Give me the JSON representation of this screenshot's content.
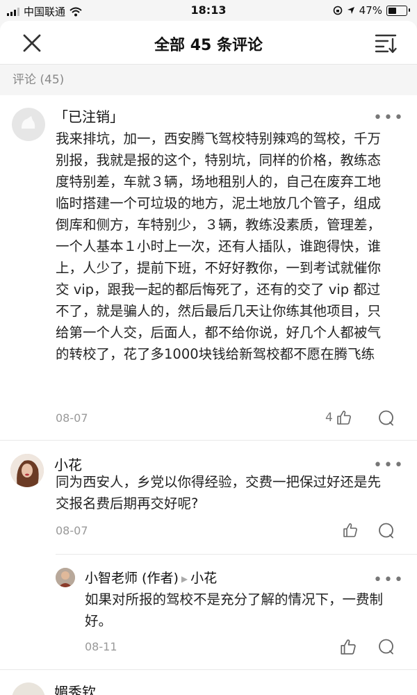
{
  "status_bar": {
    "carrier": "中国联通",
    "time": "18:13",
    "battery": "47%",
    "battery_level": 0.47
  },
  "header": {
    "title": "全部 45 条评论"
  },
  "comments_label": "评论 (45)",
  "comments": [
    {
      "username": "「已注销」",
      "text": "我来排坑，加一，西安腾飞驾校特别辣鸡的驾校，千万别报，我就是报的这个，特别坑，同样的价格，教练态度特别差，车就３辆，场地租别人的，自己在废弃工地临时搭建一个可垃圾的地方，泥土地放几个管子，组成倒库和侧方，车特别少，３辆，教练没素质，管理差，一个人基本１小时上一次，还有人插队，谁跑得快，谁上，人少了，提前下班，不好好教你，一到考试就催你交 vip，跟我一起的都后悔死了，还有的交了 vip 都过不了，就是骗人的，然后最后几天让你练其他项目，只给第一个人交，后面人，都不给你说，好几个人都被气的转校了，花了多1000块钱给新驾校都不愿在腾飞练",
      "date": "08-07",
      "likes": "4"
    },
    {
      "username": "小花",
      "text": "同为西安人，乡党以你得经验，交费一把保过好还是先交报名费后期再交好呢?",
      "date": "08-07",
      "likes": ""
    }
  ],
  "reply": {
    "author": "小智老师 (作者)",
    "reply_to": "小花",
    "text": "如果对所报的驾校不是充分了解的情况下，一费制好。",
    "date": "08-11"
  },
  "partial_next": {
    "username": "媚秀钦"
  }
}
